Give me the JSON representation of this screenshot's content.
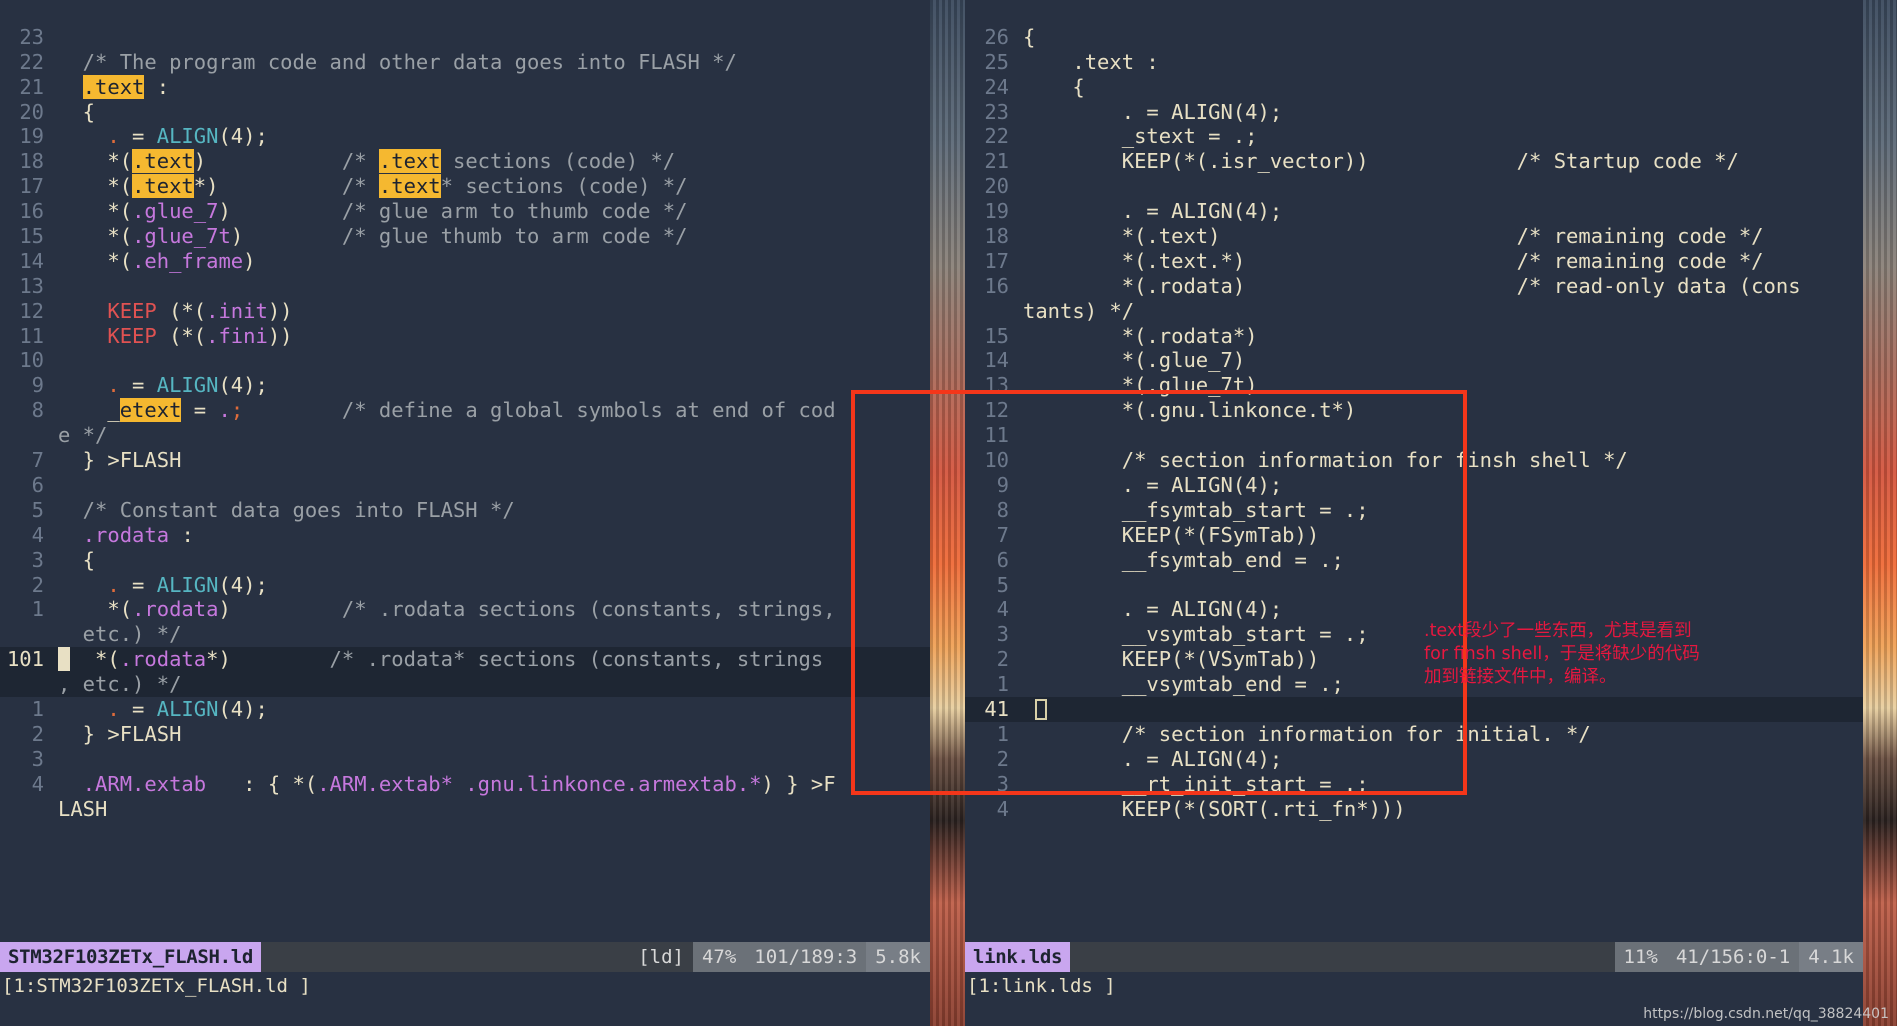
{
  "left_pane": {
    "file_label": "STM32F103ZETx_FLASH.ld",
    "status": {
      "filetype": "[ld]",
      "percent": "47%",
      "position": "101/189:3",
      "size": "5.8k"
    },
    "tabline": "[1:STM32F103ZETx_FLASH.ld ]",
    "rows": [
      {
        "ln": "23",
        "text": ""
      },
      {
        "ln": "22",
        "text": "  /* The program code and other data goes into FLASH */"
      },
      {
        "ln": "21",
        "text": "  .text :"
      },
      {
        "ln": "20",
        "text": "  {"
      },
      {
        "ln": "19",
        "text": "    . = ALIGN(4);"
      },
      {
        "ln": "18",
        "text": "    *(.text)           /* .text sections (code) */"
      },
      {
        "ln": "17",
        "text": "    *(.text*)          /* .text* sections (code) */"
      },
      {
        "ln": "16",
        "text": "    *(.glue_7)         /* glue arm to thumb code */"
      },
      {
        "ln": "15",
        "text": "    *(.glue_7t)        /* glue thumb to arm code */"
      },
      {
        "ln": "14",
        "text": "    *(.eh_frame)"
      },
      {
        "ln": "13",
        "text": ""
      },
      {
        "ln": "12",
        "text": "    KEEP (*(.init))"
      },
      {
        "ln": "11",
        "text": "    KEEP (*(.fini))"
      },
      {
        "ln": "10",
        "text": ""
      },
      {
        "ln": "9",
        "text": "    . = ALIGN(4);"
      },
      {
        "ln": "8",
        "text": "    _etext = .;        /* define a global symbols at end of cod"
      },
      {
        "ln": "",
        "text": "e */"
      },
      {
        "ln": "7",
        "text": "  } >FLASH"
      },
      {
        "ln": "6",
        "text": ""
      },
      {
        "ln": "5",
        "text": "  /* Constant data goes into FLASH */"
      },
      {
        "ln": "4",
        "text": "  .rodata :"
      },
      {
        "ln": "3",
        "text": "  {"
      },
      {
        "ln": "2",
        "text": "    . = ALIGN(4);"
      },
      {
        "ln": "1",
        "text": "    *(.rodata)         /* .rodata sections (constants, strings,"
      },
      {
        "ln": "",
        "text": "  etc.) */"
      },
      {
        "ln": "101",
        "text": "    *(.rodata*)        /* .rodata* sections (constants, strings"
      },
      {
        "ln": "",
        "text": ", etc.) */"
      },
      {
        "ln": "1",
        "text": "    . = ALIGN(4);"
      },
      {
        "ln": "2",
        "text": "  } >FLASH"
      },
      {
        "ln": "3",
        "text": ""
      },
      {
        "ln": "4",
        "text": "  .ARM.extab   : { *(.ARM.extab* .gnu.linkonce.armextab.*) } >F"
      },
      {
        "ln": "",
        "text": "LASH"
      }
    ]
  },
  "right_pane": {
    "file_label": "link.lds",
    "status": {
      "percent": "11%",
      "position": "41/156:0-1",
      "size": "4.1k"
    },
    "tabline": "[1:link.lds ]",
    "rows": [
      {
        "ln": "26",
        "text": "{"
      },
      {
        "ln": "25",
        "text": "    .text :"
      },
      {
        "ln": "24",
        "text": "    {"
      },
      {
        "ln": "23",
        "text": "        . = ALIGN(4);"
      },
      {
        "ln": "22",
        "text": "        _stext = .;"
      },
      {
        "ln": "21",
        "text": "        KEEP(*(.isr_vector))            /* Startup code */"
      },
      {
        "ln": "20",
        "text": ""
      },
      {
        "ln": "19",
        "text": "        . = ALIGN(4);"
      },
      {
        "ln": "18",
        "text": "        *(.text)                        /* remaining code */"
      },
      {
        "ln": "17",
        "text": "        *(.text.*)                      /* remaining code */"
      },
      {
        "ln": "16",
        "text": "        *(.rodata)                      /* read-only data (cons"
      },
      {
        "ln": "",
        "text": "tants) */"
      },
      {
        "ln": "15",
        "text": "        *(.rodata*)"
      },
      {
        "ln": "14",
        "text": "        *(.glue_7)"
      },
      {
        "ln": "13",
        "text": "        *(.glue_7t)"
      },
      {
        "ln": "12",
        "text": "        *(.gnu.linkonce.t*)"
      },
      {
        "ln": "11",
        "text": ""
      },
      {
        "ln": "10",
        "text": "        /* section information for finsh shell */"
      },
      {
        "ln": "9",
        "text": "        . = ALIGN(4);"
      },
      {
        "ln": "8",
        "text": "        __fsymtab_start = .;"
      },
      {
        "ln": "7",
        "text": "        KEEP(*(FSymTab))"
      },
      {
        "ln": "6",
        "text": "        __fsymtab_end = .;"
      },
      {
        "ln": "5",
        "text": ""
      },
      {
        "ln": "4",
        "text": "        . = ALIGN(4);"
      },
      {
        "ln": "3",
        "text": "        __vsymtab_start = .;"
      },
      {
        "ln": "2",
        "text": "        KEEP(*(VSymTab))"
      },
      {
        "ln": "1",
        "text": "        __vsymtab_end = .;"
      },
      {
        "ln": "41",
        "text": "",
        "cursor": true
      },
      {
        "ln": "1",
        "text": "        /* section information for initial. */"
      },
      {
        "ln": "2",
        "text": "        . = ALIGN(4);"
      },
      {
        "ln": "3",
        "text": "        __rt_init_start = .;"
      },
      {
        "ln": "4",
        "text": "        KEEP(*(SORT(.rti_fn*)))"
      }
    ]
  },
  "annotation": {
    "lines": [
      ".text段少了一些东西，尤其是看到",
      "for finsh shell，于是将缺少的代码",
      "加到链接文件中，编译。"
    ],
    "color": "#e8173f"
  },
  "watermark": "https://blog.csdn.net/qq_38824401"
}
